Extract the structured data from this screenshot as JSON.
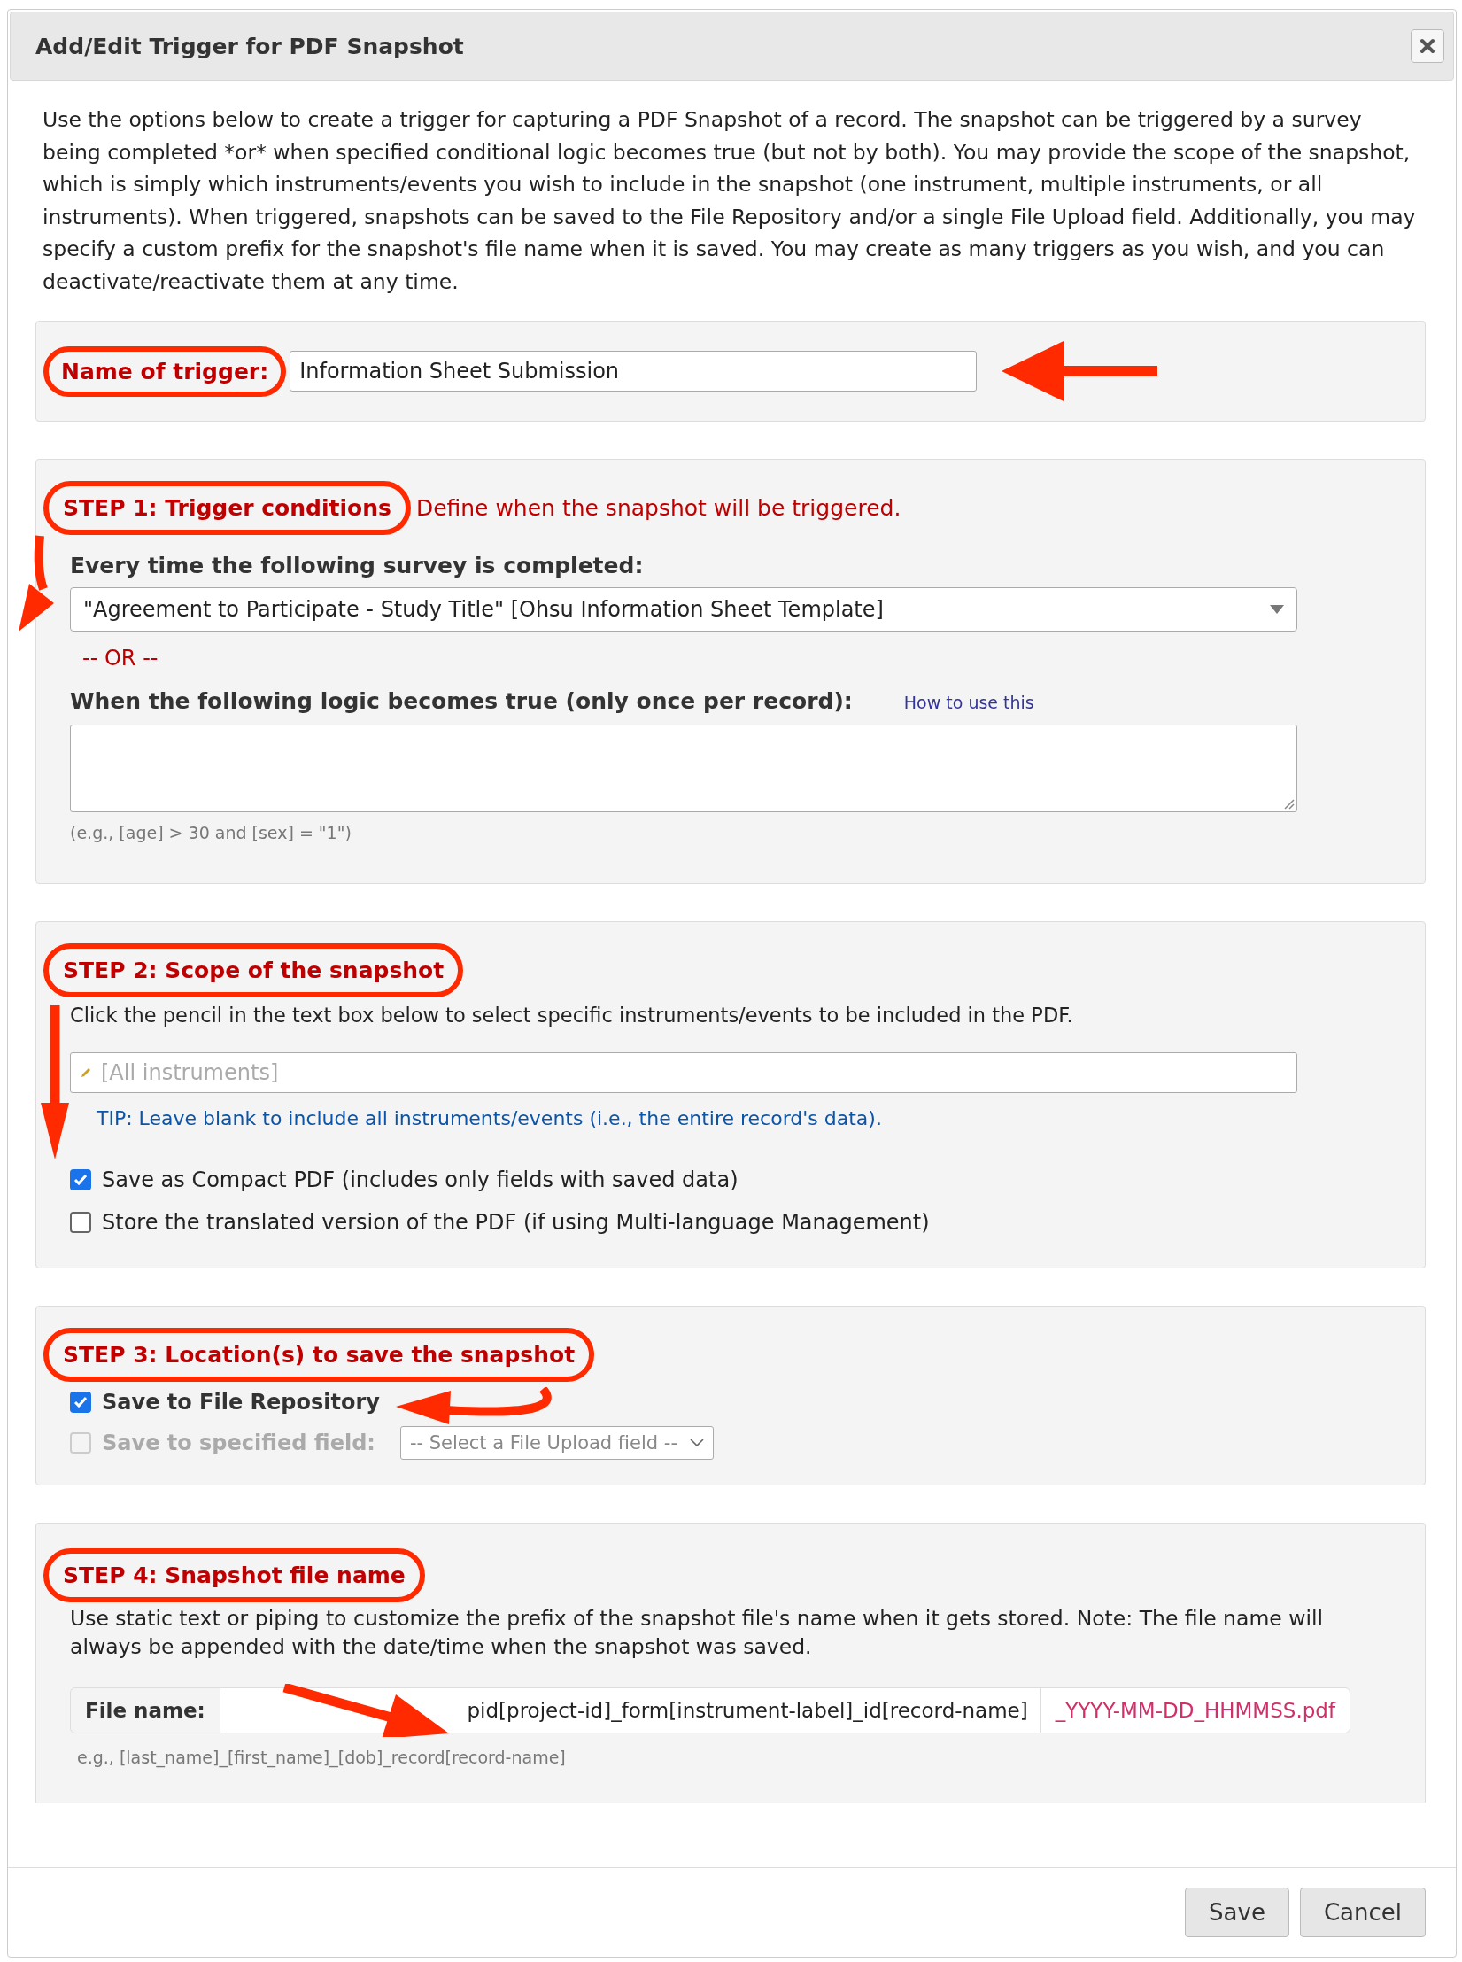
{
  "dialog": {
    "title": "Add/Edit Trigger for PDF Snapshot"
  },
  "intro": "Use the options below to create a trigger for capturing a PDF Snapshot of a record. The snapshot can be triggered by a survey being completed *or* when specified conditional logic becomes true (but not by both). You may provide the scope of the snapshot, which is simply which instruments/events you wish to include in the snapshot (one instrument, multiple instruments, or all instruments). When triggered, snapshots can be saved to the File Repository and/or a single File Upload field. Additionally, you may specify a custom prefix for the snapshot's file name when it is saved. You may create as many triggers as you wish, and you can deactivate/reactivate them at any time.",
  "name_section": {
    "label": "Name of trigger:",
    "circled": true,
    "value": "Information Sheet Submission"
  },
  "step1": {
    "heading": "STEP 1: Trigger conditions",
    "circled": true,
    "note": "Define when the snapshot will be triggered.",
    "survey_label": "Every time the following survey is completed:",
    "survey_value": "\"Agreement to Participate - Study Title\" [Ohsu Information Sheet Template]",
    "or_text": "-- OR --",
    "logic_label": "When the following logic becomes true (only once per record):",
    "logic_link": "How to use this",
    "logic_hint": "(e.g., [age] > 30 and [sex] = \"1\")"
  },
  "step2": {
    "heading": "STEP 2: Scope of the snapshot",
    "circled": true,
    "instructions": "Click the pencil in the text box below to select specific instruments/events to be included in the PDF.",
    "instruments_placeholder": "[All instruments]",
    "tip": "TIP: Leave blank to include all instruments/events (i.e., the entire record's data).",
    "options": [
      {
        "label": "Save as Compact PDF (includes only fields with saved data)",
        "checked": true
      },
      {
        "label": "Store the translated version of the PDF (if using Multi-language Management)",
        "checked": false
      }
    ]
  },
  "step3": {
    "heading": "STEP 3: Location(s) to save the snapshot",
    "circled": true,
    "options": [
      {
        "label": "Save to File Repository",
        "checked": true,
        "disabled": false
      },
      {
        "label": "Save to specified field:",
        "checked": false,
        "disabled": true,
        "select_value": "-- Select a File Upload field --"
      }
    ]
  },
  "step4": {
    "heading": "STEP 4: Snapshot file name",
    "circled": true,
    "description": "Use static text or piping to customize the prefix of the snapshot file's name when it gets stored. Note: The file name will always be appended with the date/time when the snapshot was saved.",
    "file_label": "File name:",
    "file_value": "pid[project-id]_form[instrument-label]_id[record-name]",
    "suffix": "_YYYY-MM-DD_HHMMSS.pdf",
    "example": "e.g., [last_name]_[first_name]_[dob]_record[record-name]"
  },
  "buttons": [
    {
      "label": "Save"
    },
    {
      "label": "Cancel"
    }
  ]
}
